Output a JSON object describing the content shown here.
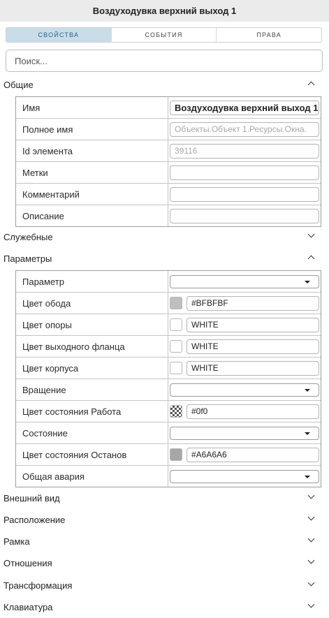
{
  "header": {
    "title": "Воздуходувка верхний выход 1"
  },
  "tabs": [
    {
      "label": "СВОЙСТВА",
      "active": true
    },
    {
      "label": "СОБЫТИЯ",
      "active": false
    },
    {
      "label": "ПРАВА",
      "active": false
    }
  ],
  "search": {
    "placeholder": "Поиск..."
  },
  "sections": {
    "general": {
      "title": "Общие",
      "expanded": true,
      "rows": {
        "name": {
          "label": "Имя",
          "value": "Воздуходувка верхний выход 1"
        },
        "full_name": {
          "label": "Полное имя",
          "value": "Объекты.Объект 1.Ресурсы.Окна."
        },
        "element_id": {
          "label": "Id элемента",
          "value": "39116"
        },
        "tags": {
          "label": "Метки",
          "value": ""
        },
        "comment": {
          "label": "Комментарий",
          "value": ""
        },
        "description": {
          "label": "Описание",
          "value": ""
        }
      }
    },
    "service": {
      "title": "Служебные",
      "expanded": false
    },
    "parameters": {
      "title": "Параметры",
      "expanded": true,
      "rows": {
        "parameter": {
          "label": "Параметр",
          "value": ""
        },
        "rim_color": {
          "label": "Цвет обода",
          "value": "#BFBFBF",
          "swatch": "#BFBFBF"
        },
        "support_color": {
          "label": "Цвет опоры",
          "value": "WHITE",
          "swatch": "#FFFFFF"
        },
        "flange_color": {
          "label": "Цвет выходного фланца",
          "value": "WHITE",
          "swatch": "#FFFFFF"
        },
        "body_color": {
          "label": "Цвет корпуса",
          "value": "WHITE",
          "swatch": "#FFFFFF"
        },
        "rotation": {
          "label": "Вращение",
          "value": ""
        },
        "work_color": {
          "label": "Цвет состояния Работа",
          "value": "#0f0",
          "swatch": "checker"
        },
        "state": {
          "label": "Состояние",
          "value": ""
        },
        "stop_color": {
          "label": "Цвет состояния Останов",
          "value": "#A6A6A6",
          "swatch": "#A6A6A6"
        },
        "general_alarm": {
          "label": "Общая авария",
          "value": ""
        }
      }
    },
    "appearance": {
      "title": "Внешний вид",
      "expanded": false
    },
    "location": {
      "title": "Расположение",
      "expanded": false
    },
    "frame": {
      "title": "Рамка",
      "expanded": false
    },
    "relations": {
      "title": "Отношения",
      "expanded": false
    },
    "transform": {
      "title": "Трансформация",
      "expanded": false
    },
    "keyboard": {
      "title": "Клавиатура",
      "expanded": false
    }
  },
  "colors": {
    "tab_active_bg": "#c9dde9",
    "tab_active_text": "#2e5f86",
    "header_bg": "#ebebeb"
  }
}
